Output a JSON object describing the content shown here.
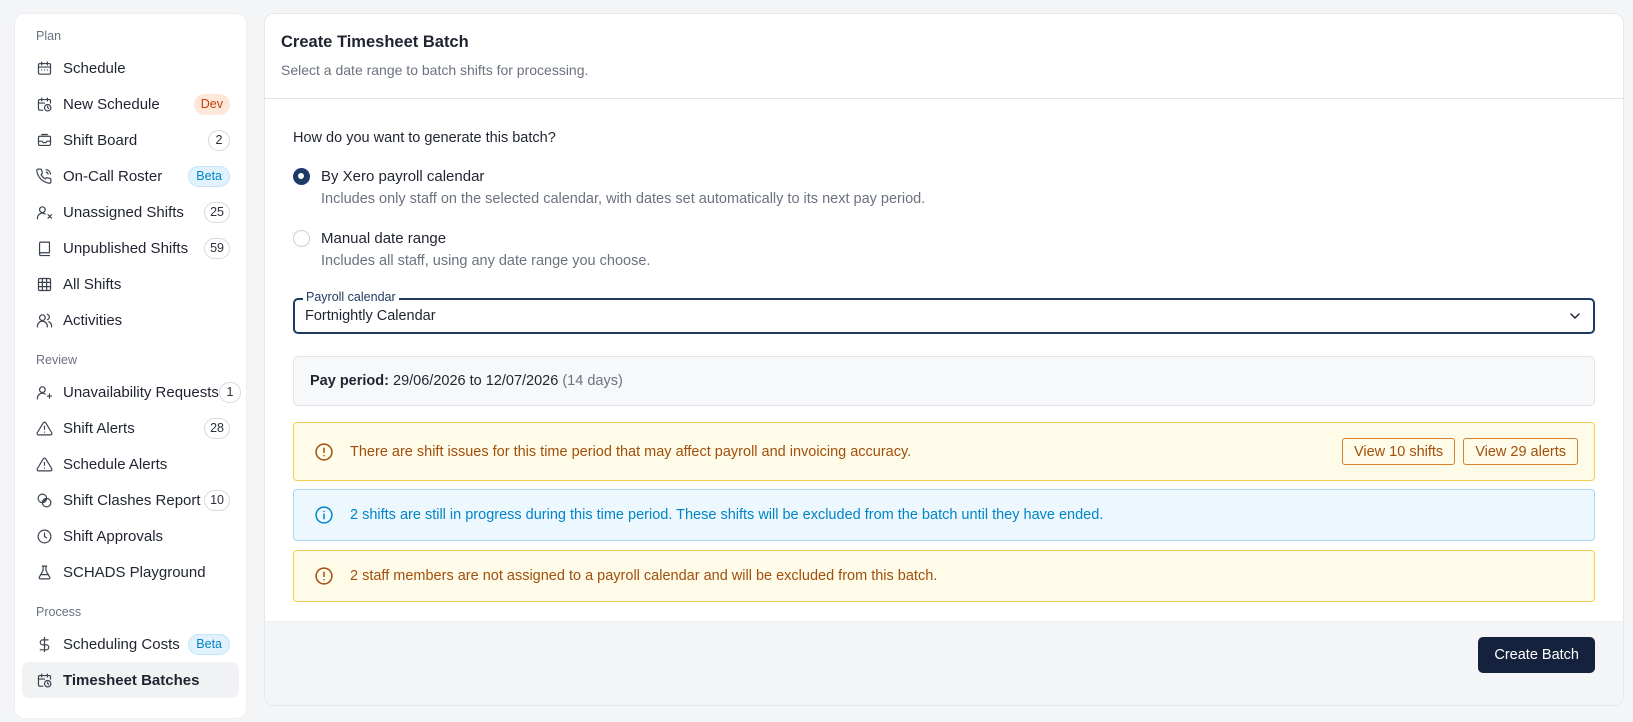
{
  "sidebar": {
    "sections": [
      {
        "label": "Plan",
        "items": [
          {
            "label": "Schedule",
            "icon": "calendar-icon"
          },
          {
            "label": "New Schedule",
            "icon": "calendar-clock-icon",
            "badge": "Dev",
            "badge_type": "dev"
          },
          {
            "label": "Shift Board",
            "icon": "inbox-icon",
            "badge": "2",
            "badge_type": "count"
          },
          {
            "label": "On-Call Roster",
            "icon": "phone-icon",
            "badge": "Beta",
            "badge_type": "beta"
          },
          {
            "label": "Unassigned Shifts",
            "icon": "user-x-icon",
            "badge": "25",
            "badge_type": "count"
          },
          {
            "label": "Unpublished Shifts",
            "icon": "book-icon",
            "badge": "59",
            "badge_type": "count"
          },
          {
            "label": "All Shifts",
            "icon": "table-icon"
          },
          {
            "label": "Activities",
            "icon": "users-icon"
          }
        ]
      },
      {
        "label": "Review",
        "items": [
          {
            "label": "Unavailability Requests",
            "icon": "user-plus-icon",
            "badge": "1",
            "badge_type": "count"
          },
          {
            "label": "Shift Alerts",
            "icon": "warning-triangle-icon",
            "badge": "28",
            "badge_type": "count"
          },
          {
            "label": "Schedule Alerts",
            "icon": "warning-triangle-icon"
          },
          {
            "label": "Shift Clashes Report",
            "icon": "overlap-icon",
            "badge": "10",
            "badge_type": "count"
          },
          {
            "label": "Shift Approvals",
            "icon": "clock-icon"
          },
          {
            "label": "SCHADS Playground",
            "icon": "flask-icon"
          }
        ]
      },
      {
        "label": "Process",
        "items": [
          {
            "label": "Scheduling Costs",
            "icon": "dollar-icon",
            "badge": "Beta",
            "badge_type": "beta"
          },
          {
            "label": "Timesheet Batches",
            "icon": "calendar-clock-icon",
            "active": true
          }
        ]
      }
    ]
  },
  "header": {
    "title": "Create Timesheet Batch",
    "subtitle": "Select a date range to batch shifts for processing."
  },
  "form": {
    "question": "How do you want to generate this batch?",
    "options": [
      {
        "label": "By Xero payroll calendar",
        "description": "Includes only staff on the selected calendar, with dates set automatically to its next pay period.",
        "checked": true
      },
      {
        "label": "Manual date range",
        "description": "Includes all staff, using any date range you choose.",
        "checked": false
      }
    ],
    "calendar_select": {
      "label": "Payroll calendar",
      "value": "Fortnightly Calendar"
    },
    "pay_period": {
      "label": "Pay period:",
      "start": "29/06/2026",
      "to": "to",
      "end": "12/07/2026",
      "duration": "(14 days)"
    }
  },
  "alerts": {
    "shift_issues": {
      "text": "There are shift issues for this time period that may affect payroll and invoicing accuracy.",
      "view_shifts_label": "View 10 shifts",
      "view_alerts_label": "View 29 alerts"
    },
    "in_progress": {
      "text": "2 shifts are still in progress during this time period. These shifts will be excluded from the batch until they have ended."
    },
    "unassigned_staff": {
      "text": "2 staff members are not assigned to a payroll calendar and will be excluded from this batch."
    }
  },
  "footer": {
    "create_label": "Create Batch"
  },
  "colors": {
    "primary": "#14223d",
    "warning_bg": "#fefbe8",
    "warning_text": "#a14f0c",
    "info_bg": "#ecf8fe",
    "info_text": "#0284c7"
  }
}
